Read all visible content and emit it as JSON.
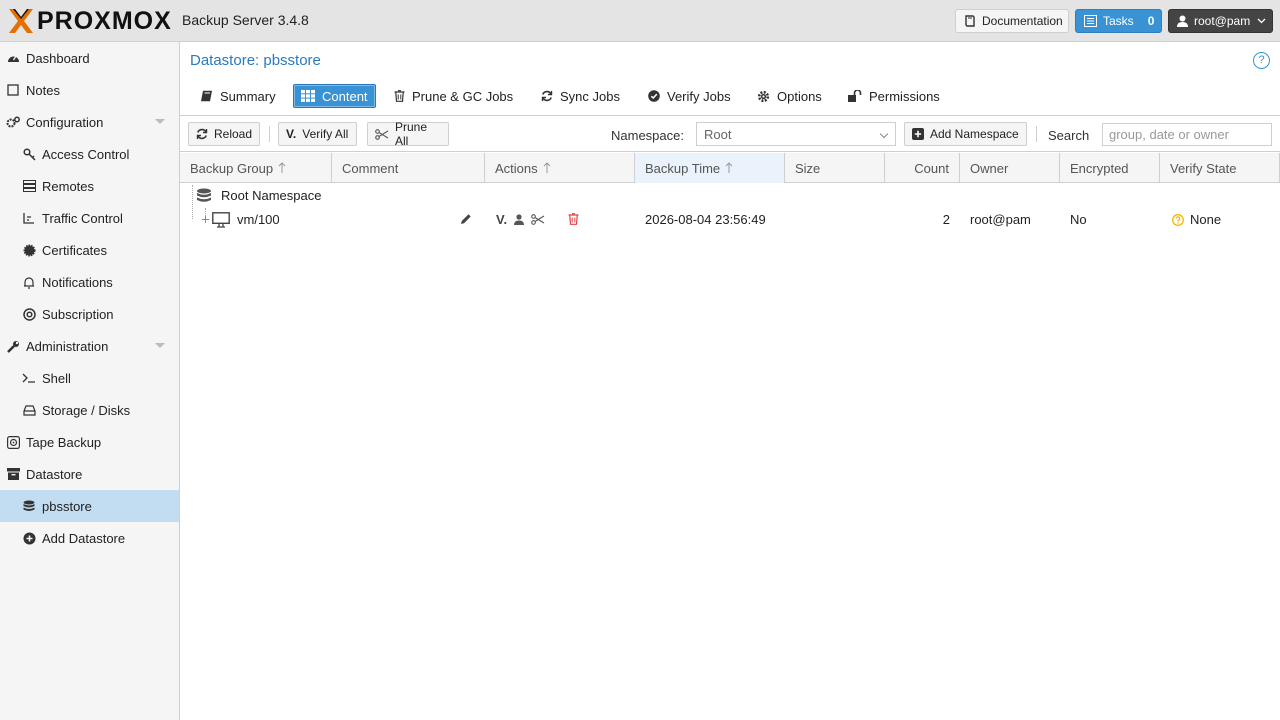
{
  "header": {
    "brand": "PROXMOX",
    "product": "Backup Server 3.4.8",
    "documentation_label": "Documentation",
    "tasks_label": "Tasks",
    "tasks_count": "0",
    "user_label": "root@pam"
  },
  "sidebar": {
    "items": [
      {
        "label": "Dashboard",
        "icon": "dashboard-icon"
      },
      {
        "label": "Notes",
        "icon": "notes-icon"
      },
      {
        "label": "Configuration",
        "icon": "gears-icon"
      },
      {
        "label": "Access Control",
        "icon": "key-icon"
      },
      {
        "label": "Remotes",
        "icon": "server-icon"
      },
      {
        "label": "Traffic Control",
        "icon": "signal-icon"
      },
      {
        "label": "Certificates",
        "icon": "certificate-icon"
      },
      {
        "label": "Notifications",
        "icon": "bell-icon"
      },
      {
        "label": "Subscription",
        "icon": "support-icon"
      },
      {
        "label": "Administration",
        "icon": "wrench-icon"
      },
      {
        "label": "Shell",
        "icon": "terminal-icon"
      },
      {
        "label": "Storage / Disks",
        "icon": "hdd-icon"
      },
      {
        "label": "Tape Backup",
        "icon": "tape-icon"
      },
      {
        "label": "Datastore",
        "icon": "archive-icon"
      },
      {
        "label": "pbsstore",
        "icon": "database-icon"
      },
      {
        "label": "Add Datastore",
        "icon": "plus-circle-icon"
      }
    ]
  },
  "main": {
    "title": "Datastore: pbsstore",
    "tabs": [
      {
        "label": "Summary"
      },
      {
        "label": "Content"
      },
      {
        "label": "Prune & GC Jobs"
      },
      {
        "label": "Sync Jobs"
      },
      {
        "label": "Verify Jobs"
      },
      {
        "label": "Options"
      },
      {
        "label": "Permissions"
      }
    ],
    "toolbar": {
      "reload_label": "Reload",
      "verify_all_label": "Verify All",
      "prune_all_label": "Prune All",
      "namespace_label": "Namespace:",
      "namespace_value": "Root",
      "add_namespace_label": "Add Namespace",
      "search_label": "Search",
      "search_placeholder": "group, date or owner"
    },
    "columns": [
      "Backup Group",
      "Comment",
      "Actions",
      "Backup Time",
      "Size",
      "Count",
      "Owner",
      "Encrypted",
      "Verify State"
    ],
    "rows": [
      {
        "name": "Root Namespace"
      },
      {
        "name": "vm/100",
        "backup_time": "2026-08-04 23:56:49",
        "count": "2",
        "owner": "root@pam",
        "encrypted": "No",
        "verify_state": "None"
      }
    ]
  },
  "colors": {
    "accent": "#3892d4",
    "brand_orange": "#e57000",
    "selected_bg": "#c2ddf2",
    "delete_red": "#e04444",
    "warning_yellow": "#f5b800"
  }
}
